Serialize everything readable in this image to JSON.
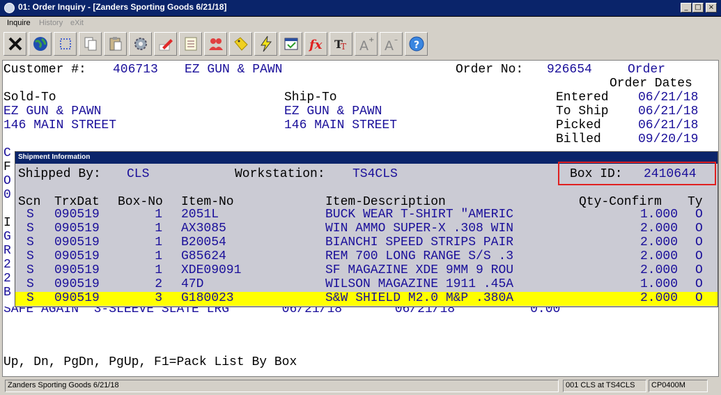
{
  "window": {
    "title": "01: Order Inquiry - [Zanders Sporting Goods 6/21/18]",
    "minimize": "_",
    "maximize": "□",
    "close": "×"
  },
  "menu": {
    "inquire": "Inquire",
    "history": "History",
    "exit": "eXit"
  },
  "toolbar": {
    "icons": [
      "close-x-icon",
      "globe-icon",
      "select-icon",
      "copy-icon",
      "paste-icon",
      "settings-icon",
      "edit-icon",
      "notes-icon",
      "users-icon",
      "tag-icon",
      "lightning-icon",
      "window-icon",
      "function-icon",
      "font-icon",
      "font-larger-icon",
      "font-smaller-icon",
      "help-icon"
    ]
  },
  "header": {
    "customer_label": "Customer #:",
    "customer_no": "406713",
    "customer_name": "EZ GUN & PAWN",
    "order_label": "Order No:",
    "order_no": "926654",
    "order_word": "Order",
    "order_dates_label": "Order Dates",
    "sold_to_label": "Sold-To",
    "ship_to_label": "Ship-To",
    "sold_to_name": "EZ GUN & PAWN",
    "sold_to_addr": "146 MAIN STREET",
    "ship_to_name": "EZ GUN & PAWN",
    "ship_to_addr": "146 MAIN STREET",
    "entered_label": "Entered",
    "entered": "06/21/18",
    "to_ship_label": "To Ship",
    "to_ship": "06/21/18",
    "picked_label": "Picked",
    "picked": "06/21/18",
    "billed_label": "Billed",
    "billed": "09/20/19"
  },
  "background_fragments": {
    "left_chars": [
      "C",
      "F",
      "O",
      "0",
      "I",
      "G",
      "R",
      "2",
      "2",
      "B"
    ],
    "bottom_row": "SAFE AGAIN  3-SLEEVE SLATE LRG       06/21/18       06/21/18          0.00"
  },
  "shipment": {
    "title": "Shipment Information",
    "shipped_by_label": "Shipped By:",
    "shipped_by": "CLS",
    "workstation_label": "Workstation:",
    "workstation": "TS4CLS",
    "box_id_label": "Box ID:",
    "box_id": "2410644",
    "columns": {
      "scn": "Scn",
      "trxdat": "TrxDat",
      "boxno": "Box-No",
      "itemno": "Item-No",
      "desc": "Item-Description",
      "qty": "Qty-Confirm",
      "ty": "Ty"
    },
    "rows": [
      {
        "scn": "S",
        "trxdat": "090519",
        "box": "1",
        "item": "2051L",
        "desc": "BUCK WEAR T-SHIRT \"AMERIC",
        "qty": "1.000",
        "ty": "O"
      },
      {
        "scn": "S",
        "trxdat": "090519",
        "box": "1",
        "item": "AX3085",
        "desc": "WIN AMMO SUPER-X .308 WIN",
        "qty": "2.000",
        "ty": "O"
      },
      {
        "scn": "S",
        "trxdat": "090519",
        "box": "1",
        "item": "B20054",
        "desc": "BIANCHI SPEED STRIPS PAIR",
        "qty": "2.000",
        "ty": "O"
      },
      {
        "scn": "S",
        "trxdat": "090519",
        "box": "1",
        "item": "G85624",
        "desc": "REM 700 LONG RANGE S/S .3",
        "qty": "2.000",
        "ty": "O"
      },
      {
        "scn": "S",
        "trxdat": "090519",
        "box": "1",
        "item": "XDE09091",
        "desc": "SF MAGAZINE XDE 9MM 9 ROU",
        "qty": "2.000",
        "ty": "O"
      },
      {
        "scn": "S",
        "trxdat": "090519",
        "box": "2",
        "item": "47D",
        "desc": "WILSON MAGAZINE 1911 .45A",
        "qty": "1.000",
        "ty": "O"
      },
      {
        "scn": "S",
        "trxdat": "090519",
        "box": "3",
        "item": "G180023",
        "desc": "S&W SHIELD M2.0 M&P .380A",
        "qty": "2.000",
        "ty": "O"
      }
    ]
  },
  "footer": {
    "keys": "Up, Dn, PgDn, PgUp, F1=Pack List By Box"
  },
  "status": {
    "company": "Zanders Sporting Goods 6/21/18",
    "session": "001 CLS at TS4CLS",
    "program": "CP0400M"
  },
  "colors": {
    "title_bg": "#0a246a",
    "screen_text_blue": "#1a0f9a",
    "highlight": "#ffff00",
    "box_frame": "#e02020"
  }
}
